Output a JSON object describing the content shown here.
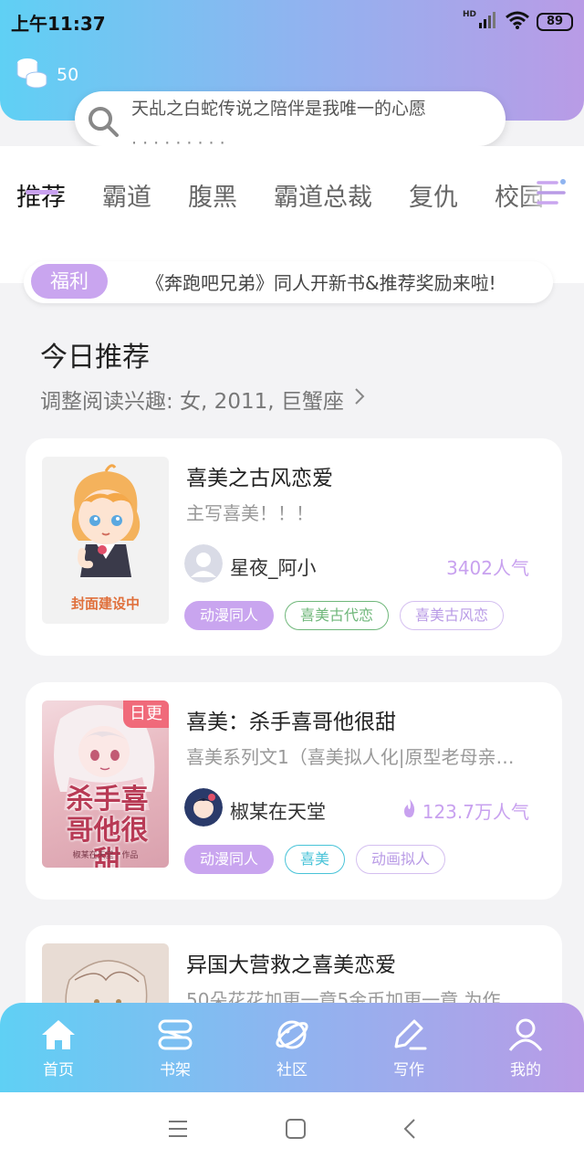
{
  "status_bar": {
    "time": "上午11:37",
    "network_label": "HD",
    "battery": "89"
  },
  "header": {
    "coins": "50",
    "search": {
      "text": "天乩之白蛇传说之陪伴是我唯一的心愿",
      "ghost_text": "· · · · · · · · ·"
    }
  },
  "tabs": [
    {
      "label": "推荐",
      "active": true
    },
    {
      "label": "霸道",
      "active": false
    },
    {
      "label": "腹黑",
      "active": false
    },
    {
      "label": "霸道总裁",
      "active": false
    },
    {
      "label": "复仇",
      "active": false
    },
    {
      "label": "校园",
      "active": false
    }
  ],
  "notice": {
    "badge": "福利",
    "text": "《奔跑吧兄弟》同人开新书&推荐奖励来啦!"
  },
  "section": {
    "title": "今日推荐",
    "subtitle": "调整阅读兴趣: 女, 2011, 巨蟹座"
  },
  "books": [
    {
      "title": "喜美之古风恋爱",
      "desc": "主写喜美！！！",
      "cover_label": "封面建设中",
      "author": "星夜_阿小",
      "popularity": "3402人气",
      "tags": [
        {
          "label": "动漫同人",
          "style": "filled"
        },
        {
          "label": "喜美古代恋",
          "style": "green"
        },
        {
          "label": "喜美古风恋",
          "style": "purple"
        }
      ]
    },
    {
      "title": "喜美：杀手喜哥他很甜",
      "desc": "喜美系列文1（喜美拟人化|原型老母亲…",
      "cover_title": "杀手喜哥他很甜",
      "cover_author": "椒某在天堂 | 作品",
      "badge": "日更",
      "author": "椒某在天堂",
      "popularity": "123.7万人气",
      "tags": [
        {
          "label": "动漫同人",
          "style": "filled"
        },
        {
          "label": "喜美",
          "style": "cyan"
        },
        {
          "label": "动画拟人",
          "style": "purple"
        }
      ]
    },
    {
      "title": "异国大营救之喜美恋爱",
      "desc": "50朵花花加更一章5金币加更一章 为作"
    }
  ],
  "bottom_nav": [
    {
      "label": "首页",
      "icon": "home-icon"
    },
    {
      "label": "书架",
      "icon": "bookshelf-icon"
    },
    {
      "label": "社区",
      "icon": "planet-icon"
    },
    {
      "label": "写作",
      "icon": "pen-icon"
    },
    {
      "label": "我的",
      "icon": "profile-icon"
    }
  ],
  "colors": {
    "accent": "#c9a5ef",
    "gradient_start": "#5fd0f4",
    "gradient_end": "#b99be6"
  }
}
